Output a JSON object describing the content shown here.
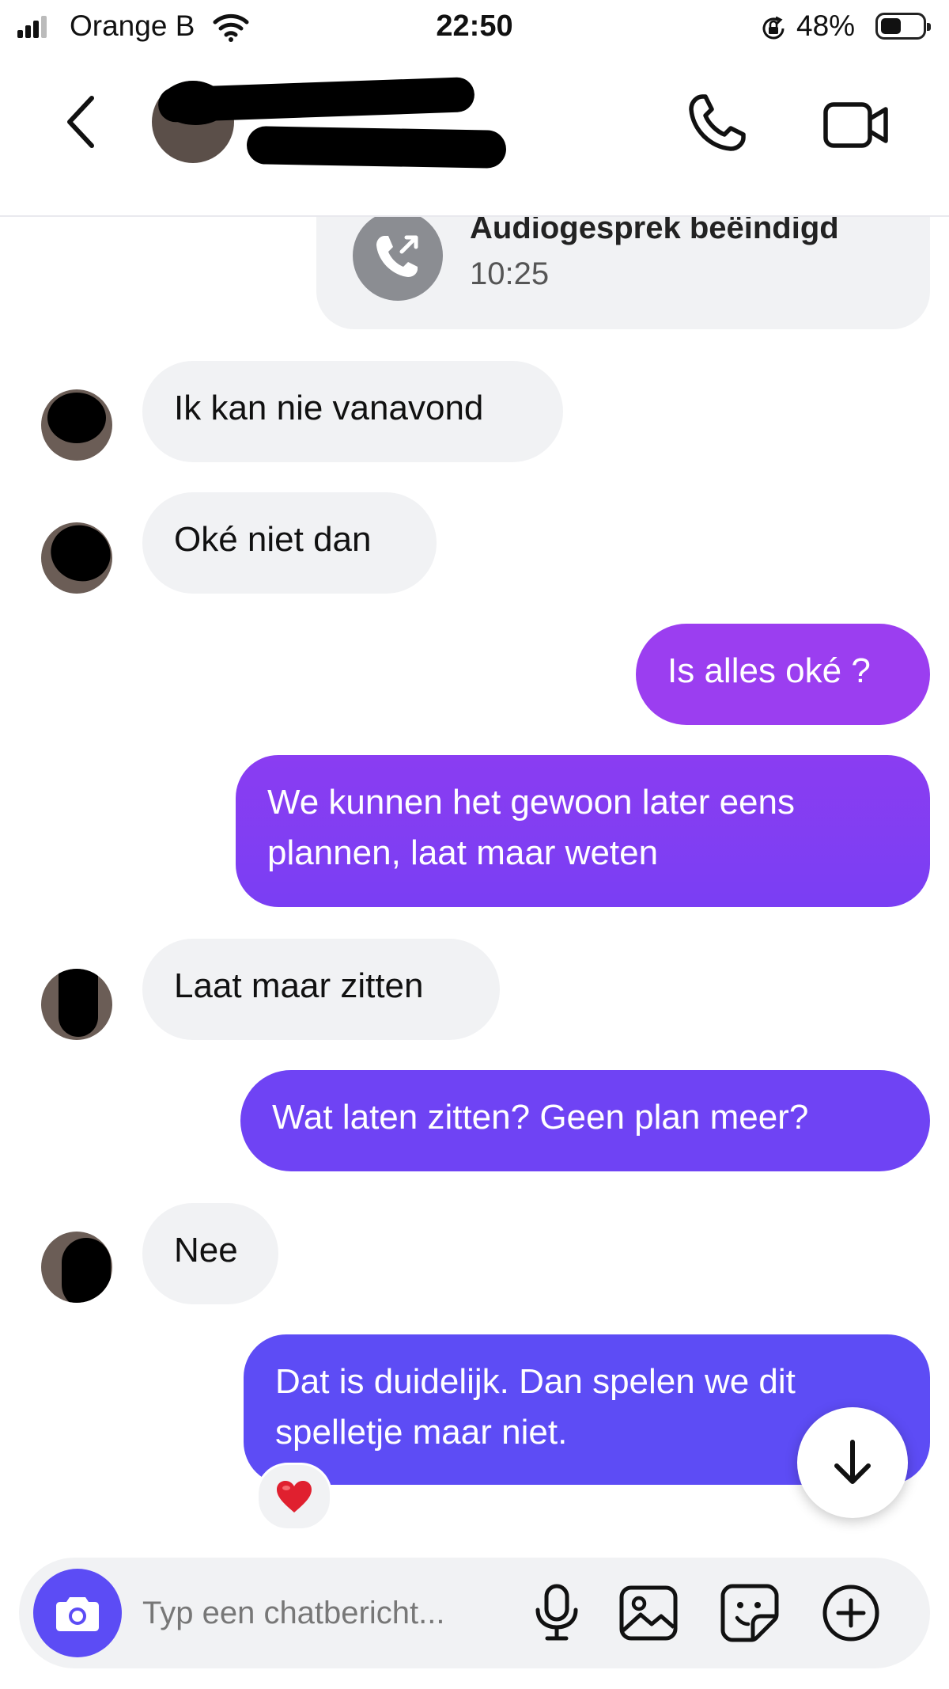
{
  "status_bar": {
    "carrier": "Orange B",
    "time": "22:50",
    "battery": "48%",
    "battery_level": 0.48
  },
  "call_card": {
    "title": "Audiogesprek beëindigd",
    "time": "10:25"
  },
  "messages": [
    {
      "direction": "incoming",
      "text": "Ik kan nie vanavond"
    },
    {
      "direction": "incoming",
      "text": "Oké niet dan"
    },
    {
      "direction": "outgoing",
      "text": "Is alles oké ?"
    },
    {
      "direction": "outgoing",
      "text": "We kunnen het gewoon later eens plannen, laat maar weten"
    },
    {
      "direction": "incoming",
      "text": "Laat maar zitten"
    },
    {
      "direction": "outgoing",
      "text": "Wat laten zitten? Geen plan meer?"
    },
    {
      "direction": "incoming",
      "text": "Nee"
    },
    {
      "direction": "outgoing",
      "text": "Dat is duidelijk. Dan spelen we dit spelletje maar niet."
    }
  ],
  "reaction": "❤️",
  "composer": {
    "placeholder": "Typ een chatbericht..."
  },
  "colors": {
    "outgoing_top": "#9b3ef0",
    "outgoing_mid": "#7d3cf2",
    "outgoing_bottom": "#5d4cf5",
    "incoming_bg": "#f1f2f4",
    "camera_button": "#5c4cf5"
  },
  "icons": {
    "header": [
      "chevron-left-icon",
      "phone-icon",
      "video-camera-icon"
    ],
    "composer": [
      "camera-icon",
      "microphone-icon",
      "image-icon",
      "sticker-icon",
      "plus-circle-icon"
    ],
    "scroll": "arrow-down-icon"
  }
}
